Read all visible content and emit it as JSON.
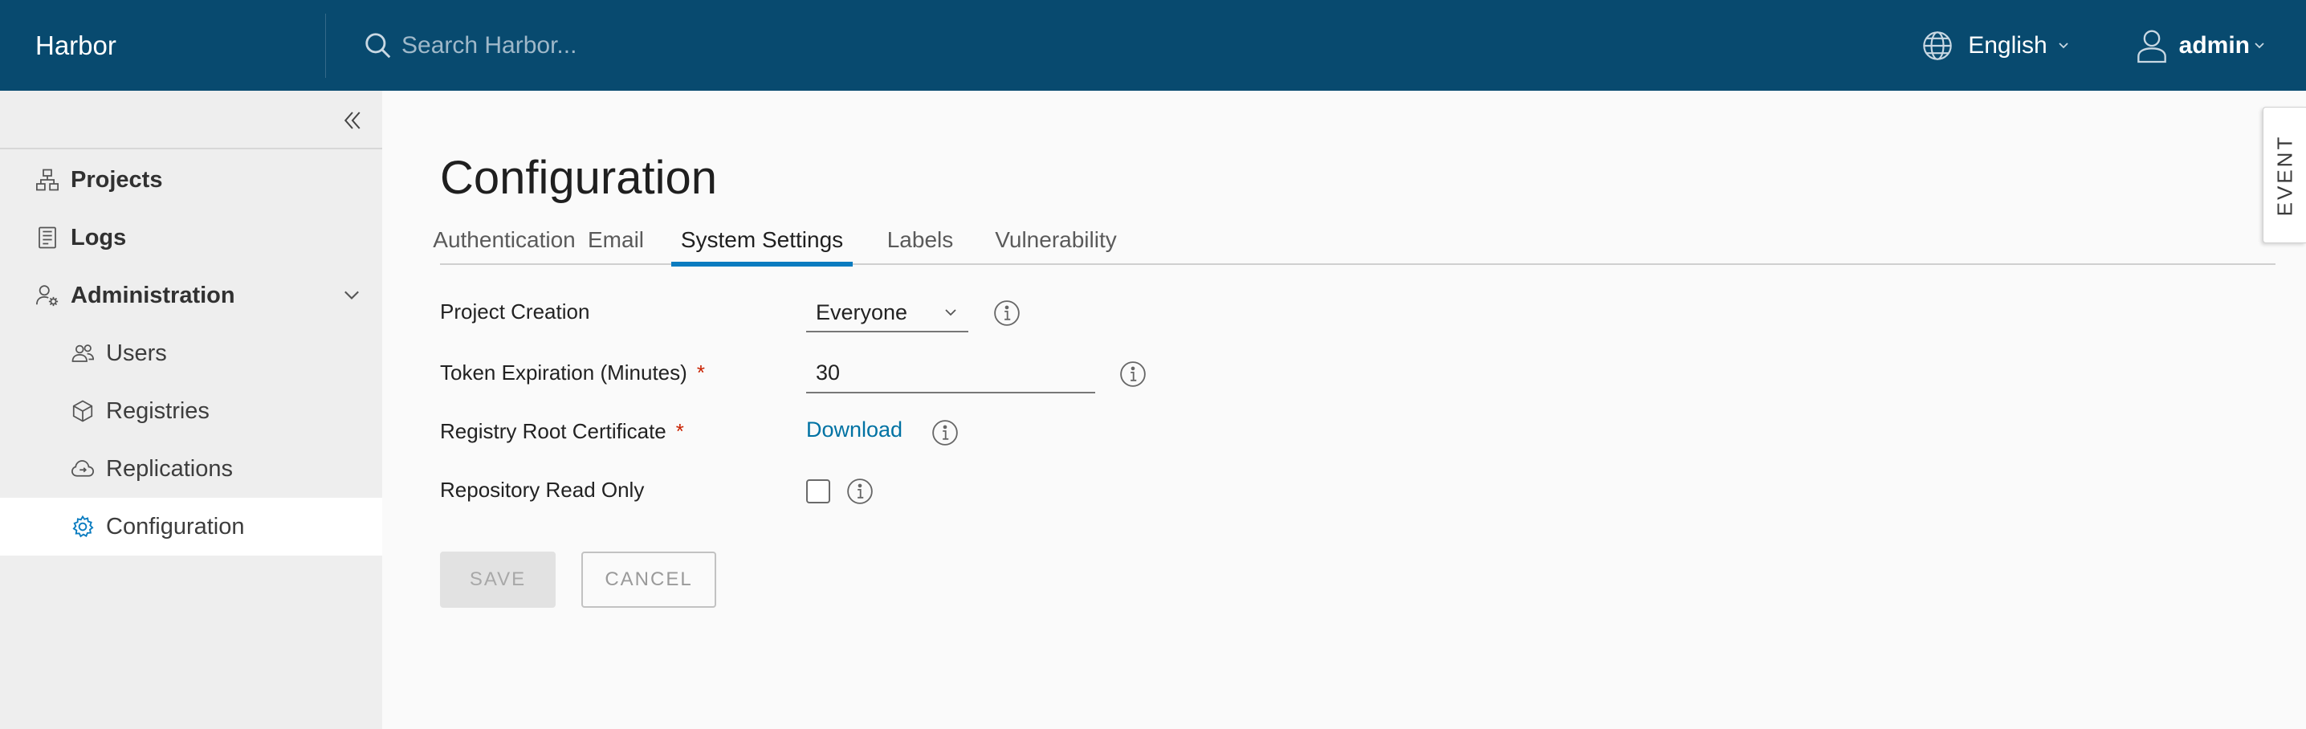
{
  "header": {
    "brand": "Harbor",
    "search_placeholder": "Search Harbor...",
    "language": "English",
    "user": "admin",
    "background_color": "#084a6f"
  },
  "sidebar": {
    "collapse_icon": "double-chevron-left-icon",
    "items": [
      {
        "label": "Projects",
        "icon": "projects-icon",
        "level": "top"
      },
      {
        "label": "Logs",
        "icon": "logs-icon",
        "level": "top"
      },
      {
        "label": "Administration",
        "icon": "administration-icon",
        "level": "top",
        "expanded": true
      },
      {
        "label": "Users",
        "icon": "users-icon",
        "level": "sub"
      },
      {
        "label": "Registries",
        "icon": "registries-icon",
        "level": "sub"
      },
      {
        "label": "Replications",
        "icon": "replications-icon",
        "level": "sub"
      },
      {
        "label": "Configuration",
        "icon": "configuration-icon",
        "level": "sub",
        "active": true
      }
    ]
  },
  "main": {
    "title": "Configuration",
    "tabs": [
      {
        "label": "Authentication",
        "active": false
      },
      {
        "label": "Email",
        "active": false
      },
      {
        "label": "System Settings",
        "active": true
      },
      {
        "label": "Labels",
        "active": false
      },
      {
        "label": "Vulnerability",
        "active": false
      }
    ],
    "form": {
      "project_creation": {
        "label": "Project Creation",
        "value": "Everyone"
      },
      "token_expiration": {
        "label": "Token Expiration (Minutes)",
        "required_mark": "*",
        "value": "30"
      },
      "registry_root_certificate": {
        "label": "Registry Root Certificate",
        "required_mark": "*",
        "link": "Download"
      },
      "repository_read_only": {
        "label": "Repository Read Only",
        "checked": false
      }
    },
    "buttons": {
      "save": "SAVE",
      "cancel": "CANCEL"
    },
    "accent_color": "#0a7cc0",
    "link_color": "#0072a3",
    "required_color": "#c92100"
  },
  "event_tab": {
    "label": "EVENT"
  }
}
